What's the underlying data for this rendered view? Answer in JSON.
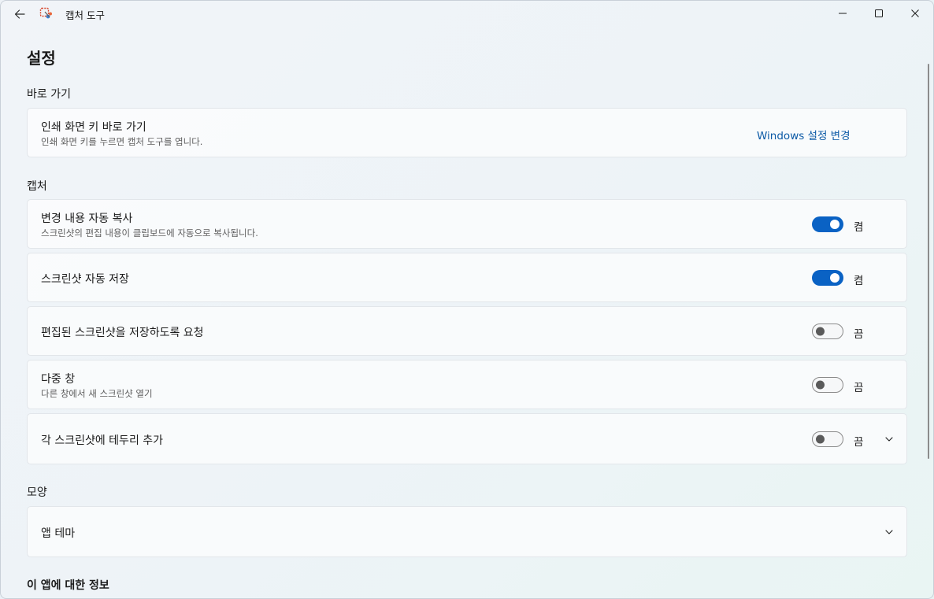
{
  "window": {
    "title": "캡처 도구"
  },
  "page": {
    "title": "설정"
  },
  "sections": {
    "shortcut": {
      "label": "바로 가기",
      "print_screen": {
        "title": "인쇄 화면 키 바로 가기",
        "desc": "인쇄 화면 키를 누르면 캡처 도구를 엽니다.",
        "link": "Windows 설정 변경"
      }
    },
    "capture": {
      "label": "캡처",
      "items": [
        {
          "title": "변경 내용 자동 복사",
          "desc": "스크린샷의 편집 내용이 클립보드에 자동으로 복사됩니다.",
          "state": "켬",
          "on": true
        },
        {
          "title": "스크린샷 자동 저장",
          "desc": "",
          "state": "켬",
          "on": true
        },
        {
          "title": "편집된 스크린샷을 저장하도록 요청",
          "desc": "",
          "state": "끔",
          "on": false
        },
        {
          "title": "다중 창",
          "desc": "다른 창에서 새 스크린샷 열기",
          "state": "끔",
          "on": false
        },
        {
          "title": "각 스크린샷에 테두리 추가",
          "desc": "",
          "state": "끔",
          "on": false,
          "expandable": true
        }
      ]
    },
    "appearance": {
      "label": "모양",
      "theme": {
        "title": "앱 테마"
      }
    },
    "about": {
      "label": "이 앱에 대한 정보"
    }
  },
  "colors": {
    "accent": "#0a62c4",
    "link": "#0c5aa6"
  },
  "icons": {
    "back": "back-arrow-icon",
    "app": "snipping-tool-icon",
    "minimize": "minimize-icon",
    "maximize": "maximize-icon",
    "close": "close-icon",
    "expand": "chevron-down-icon"
  }
}
